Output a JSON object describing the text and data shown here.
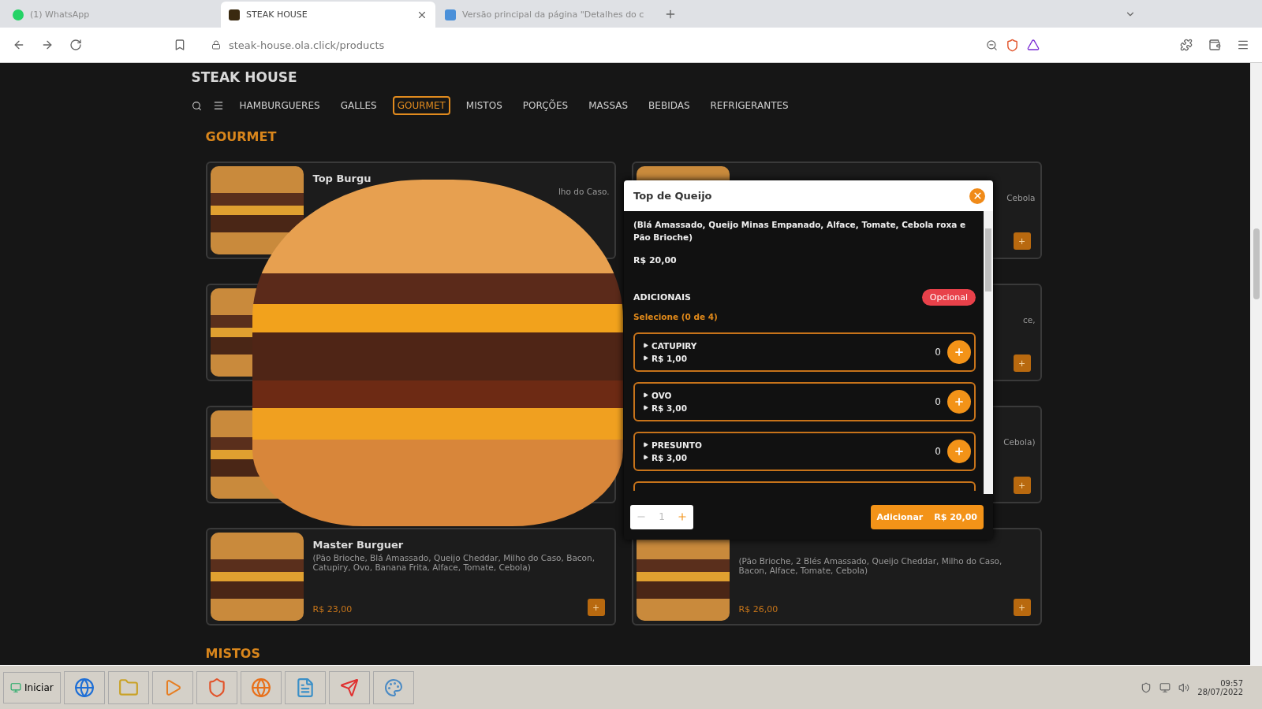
{
  "browser": {
    "tabs": [
      {
        "title": "(1) WhatsApp",
        "selected": false,
        "kind": "whatsapp"
      },
      {
        "title": "STEAK HOUSE",
        "selected": true,
        "kind": "site"
      },
      {
        "title": "Versão principal da página \"Detalhes do c",
        "selected": false,
        "kind": "page"
      }
    ],
    "address": "steak-house.ola.click/products"
  },
  "site": {
    "brand": "STEAK HOUSE",
    "nav": [
      {
        "label": "HAMBURGUERES",
        "selected": false
      },
      {
        "label": "GALLES",
        "selected": false
      },
      {
        "label": "GOURMET",
        "selected": true
      },
      {
        "label": "MISTOS",
        "selected": false
      },
      {
        "label": "PORÇÕES",
        "selected": false
      },
      {
        "label": "MASSAS",
        "selected": false
      },
      {
        "label": "BEBIDAS",
        "selected": false
      },
      {
        "label": "REFRIGERANTES",
        "selected": false
      }
    ],
    "section_title": "GOURMET",
    "products": [
      {
        "kind": "partial",
        "title": "Top Burgu",
        "description": "lho do Caso."
      },
      {
        "kind": "partial",
        "description": "Cebola",
        "add_label": "+"
      },
      {
        "kind": "partial"
      },
      {
        "kind": "partial",
        "description": "ce,",
        "add_label": "+"
      },
      {
        "kind": "partial"
      },
      {
        "kind": "partial",
        "description": "Cebola)",
        "add_label": "+"
      },
      {
        "kind": "full",
        "title": "Master Burguer",
        "description": "(Pão Brioche, Blá Amassado, Queijo Cheddar, Milho do Caso, Bacon, Catupiry, Ovo, Banana Frita, Alface, Tomate, Cebola)",
        "price": "R$ 23,00",
        "add_label": "+"
      },
      {
        "kind": "full",
        "description": "(Pão Brioche, 2 Blés Amassado, Queijo Cheddar, Milho do Caso, Bacon, Alface, Tomate, Cebola)",
        "price": "R$ 26,00",
        "add_label": "+"
      }
    ],
    "next_section": "MISTOS"
  },
  "modal": {
    "title": "Top de Queijo",
    "description": "(Blá Amassado, Queijo Minas Empanado, Alface, Tomate, Cebola roxa e Pão Brioche)",
    "price": "R$ 20,00",
    "group_title": "ADICIONAIS",
    "badge": "Opcional",
    "hint": "Selecione (0 de 4)",
    "options": [
      {
        "name": "CATUPIRY",
        "price": "R$ 1,00",
        "quantity": "0"
      },
      {
        "name": "OVO",
        "price": "R$ 3,00",
        "quantity": "0"
      },
      {
        "name": "PRESUNTO",
        "price": "R$ 3,00",
        "quantity": "0"
      }
    ],
    "amount": "1",
    "submit": "Adicionar",
    "submit_price": "R$ 20,00"
  },
  "taskbar": {
    "start": "Iniciar",
    "time": "09:57",
    "date": "28/07/2022"
  }
}
